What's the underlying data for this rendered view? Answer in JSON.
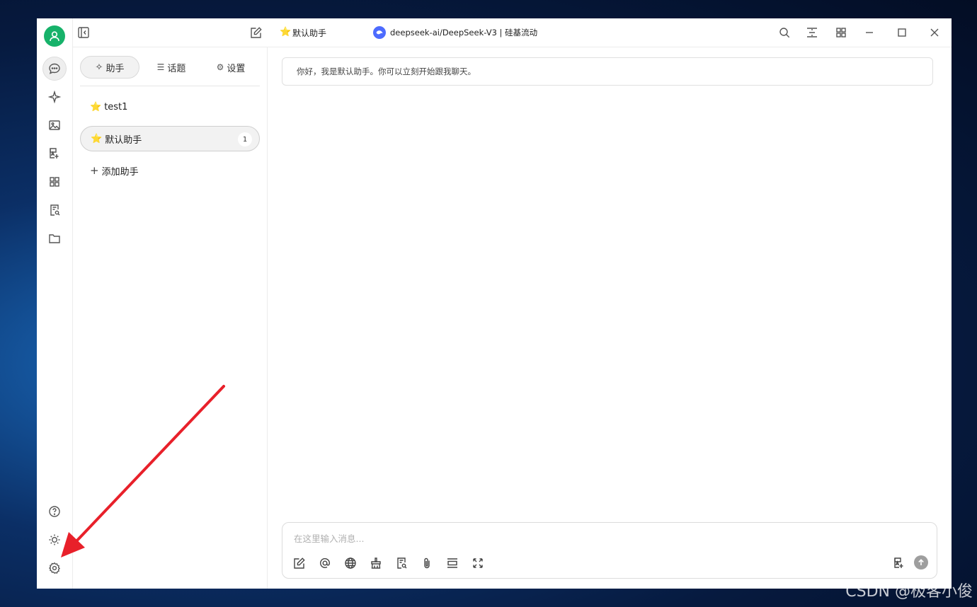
{
  "titlebar": {
    "assistant_name": "默认助手",
    "model_name": "deepseek-ai/DeepSeek-V3 | 硅基流动"
  },
  "sidebar": {
    "tabs": [
      {
        "label": "助手",
        "icon": "sparkle-icon",
        "active": true
      },
      {
        "label": "话题",
        "icon": "list-icon",
        "active": false
      },
      {
        "label": "设置",
        "icon": "gear-icon",
        "active": false
      }
    ],
    "assistants": [
      {
        "name": "test1",
        "emoji": "⭐",
        "selected": false
      },
      {
        "name": "默认助手",
        "emoji": "⭐",
        "selected": true,
        "count": "1"
      }
    ],
    "add_label": "添加助手"
  },
  "chat": {
    "greeting": "你好，我是默认助手。你可以立刻开始跟我聊天。"
  },
  "composer": {
    "placeholder": "在这里输入消息..."
  },
  "watermark": "CSDN @极客小俊",
  "colors": {
    "avatar": "#17b26a",
    "model_logo": "#4d6bfe",
    "arrow": "#e8202a"
  }
}
